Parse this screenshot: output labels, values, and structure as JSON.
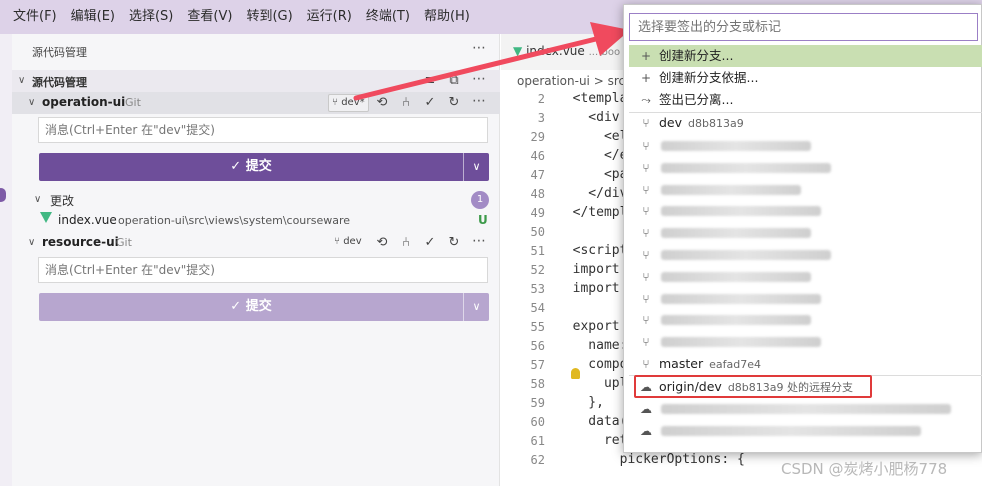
{
  "menubar": {
    "items": [
      "文件(F)",
      "编辑(E)",
      "选择(S)",
      "查看(V)",
      "转到(G)",
      "运行(R)",
      "终端(T)",
      "帮助(H)"
    ]
  },
  "sidebar": {
    "title": "源代码管理",
    "section_label": "源代码管理",
    "repos": [
      {
        "name": "operation-ui",
        "kind": "Git",
        "branch": "dev*",
        "message_placeholder": "消息(Ctrl+Enter 在\"dev\"提交)",
        "commit_label": "✓ 提交"
      },
      {
        "name": "resource-ui",
        "kind": "Git",
        "branch": "dev",
        "message_placeholder": "消息(Ctrl+Enter 在\"dev\"提交)",
        "commit_label": "✓ 提交"
      }
    ],
    "changes": {
      "label": "更改",
      "count": "1",
      "file": {
        "name": "index.vue",
        "path": "operation-ui\\src\\views\\system\\courseware",
        "status": "U"
      }
    }
  },
  "editor": {
    "tab_label": "index.vue",
    "tab_path": "...\\boo",
    "breadcrumb": "operation-ui > src",
    "lines": [
      {
        "num": "2",
        "code": "  <templa"
      },
      {
        "num": "3",
        "code": "    <div"
      },
      {
        "num": "29",
        "code": "      <el"
      },
      {
        "num": "46",
        "code": "      </e"
      },
      {
        "num": "47",
        "code": "      <pa"
      },
      {
        "num": "48",
        "code": "    </div"
      },
      {
        "num": "49",
        "code": "  </templ"
      },
      {
        "num": "50",
        "code": ""
      },
      {
        "num": "51",
        "code": "  <script"
      },
      {
        "num": "52",
        "code": "  import"
      },
      {
        "num": "53",
        "code": "  import"
      },
      {
        "num": "54",
        "code": ""
      },
      {
        "num": "55",
        "code": "  export"
      },
      {
        "num": "56",
        "code": "    name:"
      },
      {
        "num": "57",
        "code": "    compo"
      },
      {
        "num": "58",
        "code": "      uplo"
      },
      {
        "num": "59",
        "code": "    },"
      },
      {
        "num": "60",
        "code": "    data("
      },
      {
        "num": "61",
        "code": "      return {"
      },
      {
        "num": "62",
        "code": "        pickerOptions: {"
      }
    ]
  },
  "picker": {
    "placeholder": "选择要签出的分支或标记",
    "actions": [
      {
        "icon": "+",
        "label": "创建新分支..."
      },
      {
        "icon": "+",
        "label": "创建新分支依据..."
      },
      {
        "icon": "⤳",
        "label": "签出已分离..."
      }
    ],
    "branches": [
      {
        "name": "dev",
        "hash": "d8b813a9"
      },
      {
        "name": "master",
        "hash": "eafad7e4"
      }
    ],
    "remote": {
      "name": "origin/dev",
      "desc": "d8b813a9 处的远程分支"
    }
  },
  "watermark": "CSDN @炭烤小肥杨778"
}
